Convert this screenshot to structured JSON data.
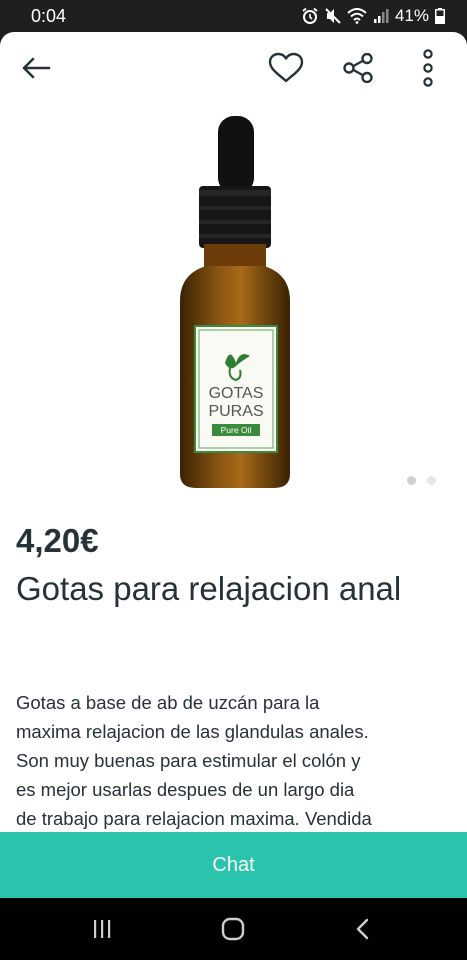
{
  "status_bar": {
    "time": "0:04",
    "battery": "41%",
    "icons": [
      "alarm-icon",
      "mute-icon",
      "wifi-icon",
      "signal-icon",
      "battery-icon"
    ]
  },
  "toolbar": {
    "icons": [
      "back-arrow-icon",
      "heart-icon",
      "share-icon",
      "more-vertical-icon"
    ]
  },
  "product_image": {
    "label_line1": "GOTAS",
    "label_line2": "PURAS",
    "label_tag": "Pure Oil"
  },
  "gallery": {
    "pages": 2,
    "current": 1
  },
  "listing": {
    "price": "4,20€",
    "title": "Gotas para relajacion anal",
    "description_lines": [
      "Gotas a base de ab de uzcán para la",
      "maxima relajacion de las glandulas anales.",
      "Son muy buenas para estimular el colón y",
      "es mejor usarlas despues de un largo dia",
      "de trabajo para relajacion maxima. Vendida"
    ]
  },
  "chat_button": {
    "label": "Chat"
  },
  "colors": {
    "accent": "#2ac4ad",
    "text": "#253238",
    "status_bar": "#1f1f1f",
    "nav_bar": "#000000"
  },
  "nav_bar": {
    "icons": [
      "recents-icon",
      "home-icon",
      "back-icon"
    ]
  }
}
